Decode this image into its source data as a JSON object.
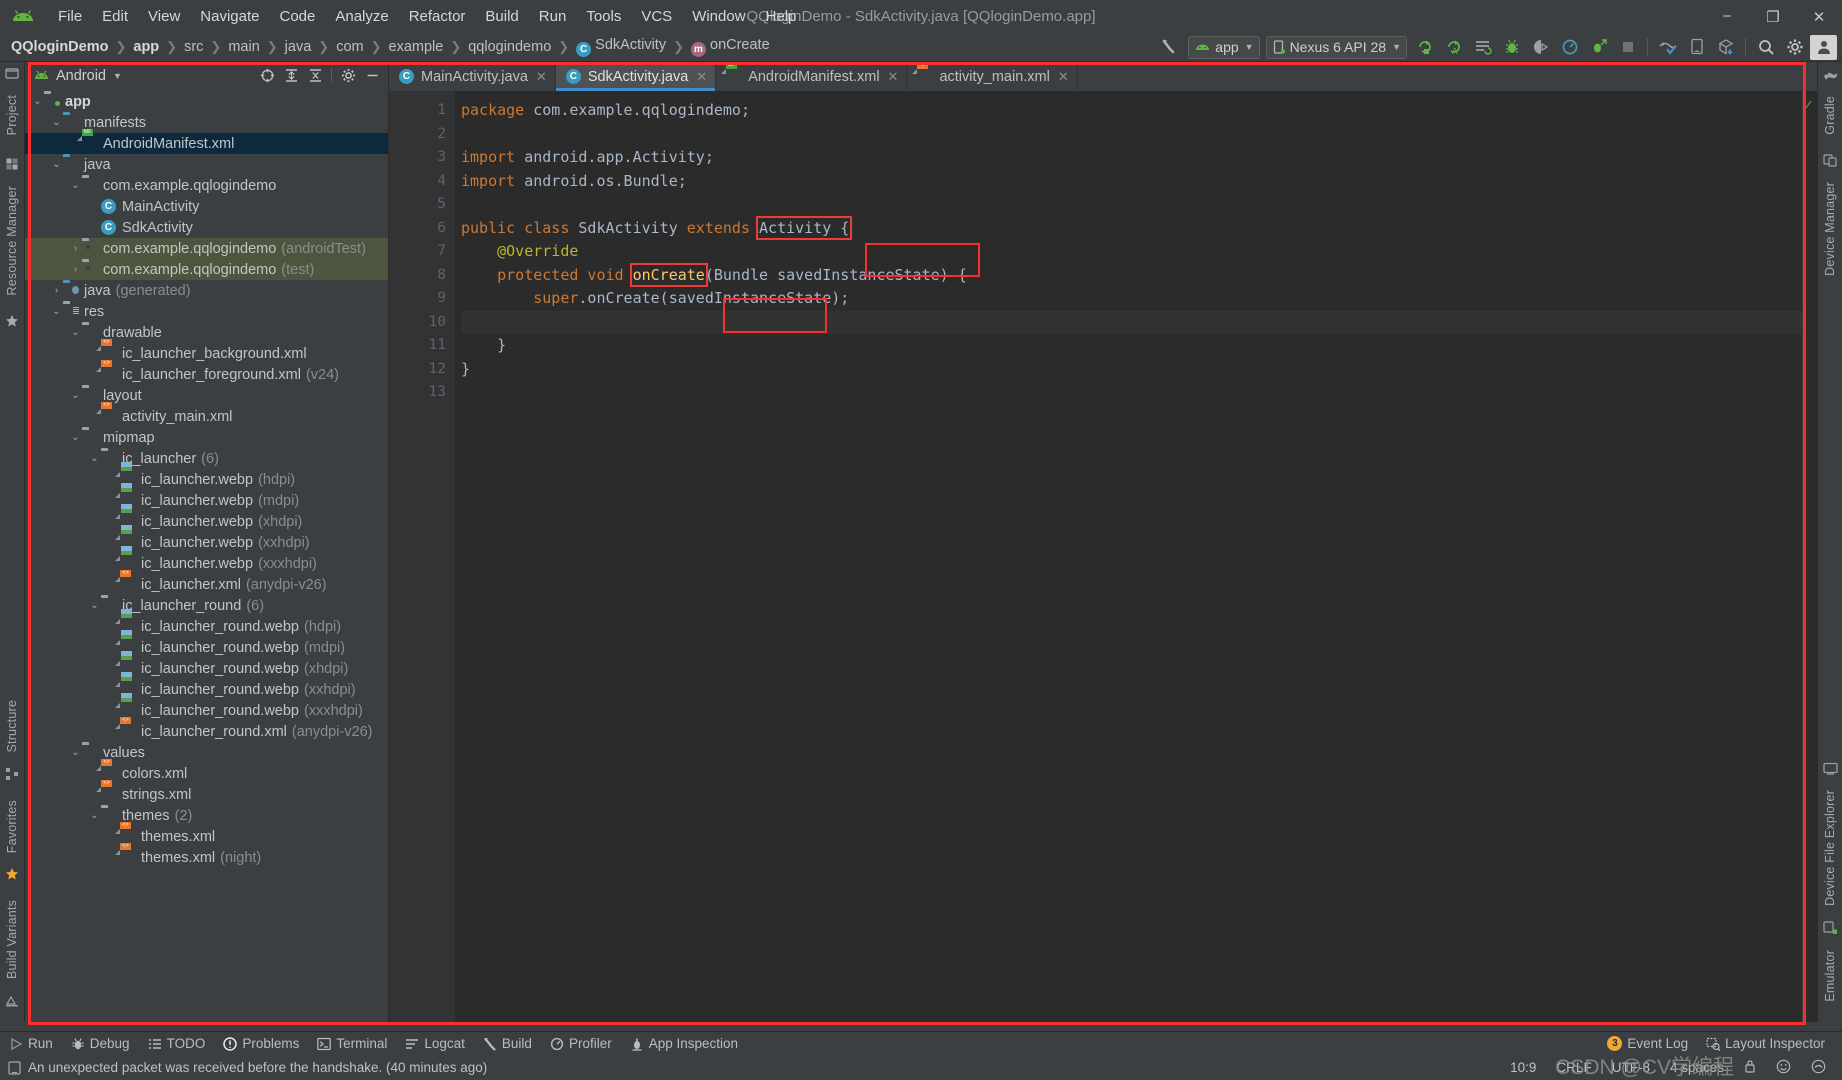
{
  "window": {
    "title": "QQloginDemo - SdkActivity.java [QQloginDemo.app]",
    "minimize": "−",
    "maximize": "❐",
    "close": "✕"
  },
  "menu": {
    "items": [
      {
        "label": "File"
      },
      {
        "label": "Edit"
      },
      {
        "label": "View"
      },
      {
        "label": "Navigate"
      },
      {
        "label": "Code"
      },
      {
        "label": "Analyze"
      },
      {
        "label": "Refactor"
      },
      {
        "label": "Build"
      },
      {
        "label": "Run"
      },
      {
        "label": "Tools"
      },
      {
        "label": "VCS"
      },
      {
        "label": "Window"
      },
      {
        "label": "Help"
      }
    ]
  },
  "breadcrumb": {
    "items": [
      {
        "label": "QQloginDemo",
        "bold": true,
        "icon": ""
      },
      {
        "label": "app",
        "bold": true,
        "icon": ""
      },
      {
        "label": "src",
        "bold": false,
        "icon": ""
      },
      {
        "label": "main",
        "bold": false,
        "icon": ""
      },
      {
        "label": "java",
        "bold": false,
        "icon": ""
      },
      {
        "label": "com",
        "bold": false,
        "icon": ""
      },
      {
        "label": "example",
        "bold": false,
        "icon": ""
      },
      {
        "label": "qqlogindemo",
        "bold": false,
        "icon": ""
      },
      {
        "label": "SdkActivity",
        "bold": false,
        "icon": "class-icon"
      },
      {
        "label": "onCreate",
        "bold": false,
        "icon": "method-icon"
      }
    ],
    "separator": "❯"
  },
  "toolbar": {
    "build_hammer": "make-project-icon",
    "module_selector": "app",
    "device_selector": "Nexus 6 API 28",
    "caret": "▼",
    "buttons": [
      "run-icon",
      "debug-app-icon",
      "apply-changes-icon",
      "debug-icon",
      "attach-debugger-icon",
      "profiler-icon",
      "attach-profiler-icon",
      "stop-icon",
      "avd-manager-icon",
      "sdk-manager-icon",
      "sync-gradle-icon",
      "search-everywhere-icon",
      "settings-gear-icon",
      "user-avatar-icon"
    ]
  },
  "project_panel": {
    "title": "Android",
    "caret": "▼",
    "actions": [
      "select-opened-file-icon",
      "expand-all-icon",
      "collapse-all-icon",
      "settings-gear-icon",
      "hide-panel-icon"
    ],
    "tree": [
      {
        "depth": 0,
        "arrow": "⌄",
        "icon": "folder-module",
        "label": "app",
        "sub": "",
        "bold": true,
        "state": ""
      },
      {
        "depth": 1,
        "arrow": "⌄",
        "icon": "folder-blue",
        "label": "manifests",
        "sub": "",
        "bold": false,
        "state": ""
      },
      {
        "depth": 2,
        "arrow": "",
        "icon": "file-manifest",
        "label": "AndroidManifest.xml",
        "sub": "",
        "bold": false,
        "state": "sel"
      },
      {
        "depth": 1,
        "arrow": "⌄",
        "icon": "folder-blue",
        "label": "java",
        "sub": "",
        "bold": false,
        "state": ""
      },
      {
        "depth": 2,
        "arrow": "⌄",
        "icon": "folder-pkg",
        "label": "com.example.qqlogindemo",
        "sub": "",
        "bold": false,
        "state": ""
      },
      {
        "depth": 3,
        "arrow": "",
        "icon": "class-icon",
        "label": "MainActivity",
        "sub": "",
        "bold": false,
        "state": ""
      },
      {
        "depth": 3,
        "arrow": "",
        "icon": "class-icon",
        "label": "SdkActivity",
        "sub": "",
        "bold": false,
        "state": ""
      },
      {
        "depth": 2,
        "arrow": "›",
        "icon": "folder-pkg",
        "label": "com.example.qqlogindemo",
        "sub": "(androidTest)",
        "bold": false,
        "state": "testsrc"
      },
      {
        "depth": 2,
        "arrow": "›",
        "icon": "folder-pkg",
        "label": "com.example.qqlogindemo",
        "sub": "(test)",
        "bold": false,
        "state": "testsrc"
      },
      {
        "depth": 1,
        "arrow": "›",
        "icon": "folder-gen",
        "label": "java",
        "sub": "(generated)",
        "bold": false,
        "state": ""
      },
      {
        "depth": 1,
        "arrow": "⌄",
        "icon": "folder-res",
        "label": "res",
        "sub": "",
        "bold": false,
        "state": ""
      },
      {
        "depth": 2,
        "arrow": "⌄",
        "icon": "folder-pkg",
        "label": "drawable",
        "sub": "",
        "bold": false,
        "state": ""
      },
      {
        "depth": 3,
        "arrow": "",
        "icon": "file-xml",
        "label": "ic_launcher_background.xml",
        "sub": "",
        "bold": false,
        "state": ""
      },
      {
        "depth": 3,
        "arrow": "",
        "icon": "file-xml",
        "label": "ic_launcher_foreground.xml",
        "sub": "(v24)",
        "bold": false,
        "state": ""
      },
      {
        "depth": 2,
        "arrow": "⌄",
        "icon": "folder-pkg",
        "label": "layout",
        "sub": "",
        "bold": false,
        "state": ""
      },
      {
        "depth": 3,
        "arrow": "",
        "icon": "file-xml",
        "label": "activity_main.xml",
        "sub": "",
        "bold": false,
        "state": ""
      },
      {
        "depth": 2,
        "arrow": "⌄",
        "icon": "folder-pkg",
        "label": "mipmap",
        "sub": "",
        "bold": false,
        "state": ""
      },
      {
        "depth": 3,
        "arrow": "⌄",
        "icon": "folder-pkg",
        "label": "ic_launcher",
        "sub": "(6)",
        "bold": false,
        "state": ""
      },
      {
        "depth": 4,
        "arrow": "",
        "icon": "file-image",
        "label": "ic_launcher.webp",
        "sub": "(hdpi)",
        "bold": false,
        "state": ""
      },
      {
        "depth": 4,
        "arrow": "",
        "icon": "file-image",
        "label": "ic_launcher.webp",
        "sub": "(mdpi)",
        "bold": false,
        "state": ""
      },
      {
        "depth": 4,
        "arrow": "",
        "icon": "file-image",
        "label": "ic_launcher.webp",
        "sub": "(xhdpi)",
        "bold": false,
        "state": ""
      },
      {
        "depth": 4,
        "arrow": "",
        "icon": "file-image",
        "label": "ic_launcher.webp",
        "sub": "(xxhdpi)",
        "bold": false,
        "state": ""
      },
      {
        "depth": 4,
        "arrow": "",
        "icon": "file-image",
        "label": "ic_launcher.webp",
        "sub": "(xxxhdpi)",
        "bold": false,
        "state": ""
      },
      {
        "depth": 4,
        "arrow": "",
        "icon": "file-xml",
        "label": "ic_launcher.xml",
        "sub": "(anydpi-v26)",
        "bold": false,
        "state": ""
      },
      {
        "depth": 3,
        "arrow": "⌄",
        "icon": "folder-pkg",
        "label": "ic_launcher_round",
        "sub": "(6)",
        "bold": false,
        "state": ""
      },
      {
        "depth": 4,
        "arrow": "",
        "icon": "file-image",
        "label": "ic_launcher_round.webp",
        "sub": "(hdpi)",
        "bold": false,
        "state": ""
      },
      {
        "depth": 4,
        "arrow": "",
        "icon": "file-image",
        "label": "ic_launcher_round.webp",
        "sub": "(mdpi)",
        "bold": false,
        "state": ""
      },
      {
        "depth": 4,
        "arrow": "",
        "icon": "file-image",
        "label": "ic_launcher_round.webp",
        "sub": "(xhdpi)",
        "bold": false,
        "state": ""
      },
      {
        "depth": 4,
        "arrow": "",
        "icon": "file-image",
        "label": "ic_launcher_round.webp",
        "sub": "(xxhdpi)",
        "bold": false,
        "state": ""
      },
      {
        "depth": 4,
        "arrow": "",
        "icon": "file-image",
        "label": "ic_launcher_round.webp",
        "sub": "(xxxhdpi)",
        "bold": false,
        "state": ""
      },
      {
        "depth": 4,
        "arrow": "",
        "icon": "file-xml",
        "label": "ic_launcher_round.xml",
        "sub": "(anydpi-v26)",
        "bold": false,
        "state": ""
      },
      {
        "depth": 2,
        "arrow": "⌄",
        "icon": "folder-pkg",
        "label": "values",
        "sub": "",
        "bold": false,
        "state": ""
      },
      {
        "depth": 3,
        "arrow": "",
        "icon": "file-xml",
        "label": "colors.xml",
        "sub": "",
        "bold": false,
        "state": ""
      },
      {
        "depth": 3,
        "arrow": "",
        "icon": "file-xml",
        "label": "strings.xml",
        "sub": "",
        "bold": false,
        "state": ""
      },
      {
        "depth": 3,
        "arrow": "⌄",
        "icon": "folder-pkg",
        "label": "themes",
        "sub": "(2)",
        "bold": false,
        "state": ""
      },
      {
        "depth": 4,
        "arrow": "",
        "icon": "file-xml",
        "label": "themes.xml",
        "sub": "",
        "bold": false,
        "state": ""
      },
      {
        "depth": 4,
        "arrow": "",
        "icon": "file-xml",
        "label": "themes.xml",
        "sub": "(night)",
        "bold": false,
        "state": ""
      }
    ]
  },
  "left_rail": {
    "items": [
      {
        "label": "Project",
        "icon": "project-icon"
      },
      {
        "label": "Resource Manager",
        "icon": "resource-manager-icon"
      },
      {
        "label": "Structure",
        "icon": "structure-icon"
      },
      {
        "label": "Favorites",
        "icon": "favorites-star-icon"
      },
      {
        "label": "Build Variants",
        "icon": "build-variants-icon"
      }
    ]
  },
  "right_rail": {
    "items": [
      {
        "label": "Gradle",
        "icon": "gradle-elephant-icon"
      },
      {
        "label": "Device Manager",
        "icon": "device-manager-icon"
      },
      {
        "label": "Device File Explorer",
        "icon": "device-file-explorer-icon"
      },
      {
        "label": "Emulator",
        "icon": "emulator-icon"
      }
    ]
  },
  "editor": {
    "tabs": [
      {
        "label": "MainActivity.java",
        "icon": "class-icon",
        "active": false,
        "close": "✕"
      },
      {
        "label": "SdkActivity.java",
        "icon": "class-icon",
        "active": true,
        "close": "✕"
      },
      {
        "label": "AndroidManifest.xml",
        "icon": "file-manifest",
        "active": false,
        "close": "✕"
      },
      {
        "label": "activity_main.xml",
        "icon": "file-xml",
        "active": false,
        "close": "✕"
      }
    ],
    "line_numbers": [
      "1",
      "2",
      "3",
      "4",
      "5",
      "6",
      "7",
      "8",
      "9",
      "10",
      "11",
      "12",
      "13"
    ],
    "code_lines": [
      {
        "n": 1,
        "tokens": [
          {
            "t": "package ",
            "c": "kw"
          },
          {
            "t": "com.example.qqlogindemo;",
            "c": "id"
          }
        ]
      },
      {
        "n": 2,
        "tokens": []
      },
      {
        "n": 3,
        "tokens": [
          {
            "t": "import ",
            "c": "kw"
          },
          {
            "t": "android.app.Activity;",
            "c": "id"
          }
        ]
      },
      {
        "n": 4,
        "tokens": [
          {
            "t": "import ",
            "c": "kw"
          },
          {
            "t": "android.os.Bundle;",
            "c": "id"
          }
        ]
      },
      {
        "n": 5,
        "tokens": []
      },
      {
        "n": 6,
        "tokens": [
          {
            "t": "public class ",
            "c": "kw"
          },
          {
            "t": "SdkActivity ",
            "c": "id"
          },
          {
            "t": "extends ",
            "c": "kw"
          },
          {
            "t": "Activity {",
            "c": "id",
            "box": true
          }
        ]
      },
      {
        "n": 7,
        "tokens": [
          {
            "t": "    @Override",
            "c": "ann"
          }
        ]
      },
      {
        "n": 8,
        "tokens": [
          {
            "t": "    protected void ",
            "c": "kw"
          },
          {
            "t": "onCreate",
            "c": "fn",
            "box": true
          },
          {
            "t": "(Bundle savedInstanceState) {",
            "c": "id"
          }
        ]
      },
      {
        "n": 9,
        "tokens": [
          {
            "t": "        super",
            "c": "kw"
          },
          {
            "t": ".onCreate(savedInstanceState);",
            "c": "id"
          }
        ]
      },
      {
        "n": 10,
        "tokens": []
      },
      {
        "n": 11,
        "tokens": [
          {
            "t": "    }",
            "c": "id"
          }
        ]
      },
      {
        "n": 12,
        "tokens": [
          {
            "t": "}",
            "c": "id"
          }
        ]
      },
      {
        "n": 13,
        "tokens": []
      }
    ],
    "inspection_status": "✓"
  },
  "bottom_tools": {
    "items": [
      {
        "label": "Run",
        "icon": "run-play-icon"
      },
      {
        "label": "Debug",
        "icon": "debug-bug-icon"
      },
      {
        "label": "TODO",
        "icon": "todo-list-icon"
      },
      {
        "label": "Problems",
        "icon": "problems-icon"
      },
      {
        "label": "Terminal",
        "icon": "terminal-icon"
      },
      {
        "label": "Logcat",
        "icon": "logcat-icon"
      },
      {
        "label": "Build",
        "icon": "build-hammer-icon"
      },
      {
        "label": "Profiler",
        "icon": "profiler-icon"
      },
      {
        "label": "App Inspection",
        "icon": "app-inspection-icon"
      }
    ],
    "right_items": [
      {
        "label": "Event Log",
        "icon": "event-log-icon",
        "count": "3"
      },
      {
        "label": "Layout Inspector",
        "icon": "layout-inspector-icon",
        "count": ""
      }
    ]
  },
  "statusbar": {
    "message": "An unexpected packet was received before the handshake. (40 minutes ago)",
    "message_icon": "notification-icon",
    "caret_position": "10:9",
    "line_separator": "CRLF",
    "encoding": "UTF-8",
    "indent": "4 spaces",
    "lock_icon": "read-only-lock-icon",
    "inspector_icon": "inspection-face-icon",
    "memory_icon": "memory-indicator-icon",
    "watermark": "CSDN @CV学编程"
  },
  "colors": {
    "accent_blue": "#3f8fd0",
    "annotation_red": "#fa2e2e",
    "keyword_orange": "#cc7832",
    "method_yellow": "#ffc66d",
    "annotation_yellow": "#bbb529",
    "green": "#62b543"
  }
}
